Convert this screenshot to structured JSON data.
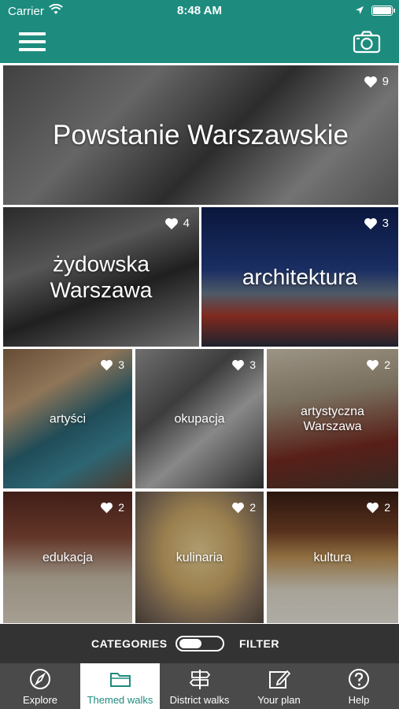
{
  "status_bar": {
    "carrier": "Carrier",
    "time": "8:48 AM"
  },
  "nav": {
    "menu_icon": "hamburger-menu-icon",
    "camera_icon": "camera-icon"
  },
  "categories": [
    {
      "label": "Powstanie Warszawskie",
      "likes": "9"
    },
    {
      "label": "żydowska Warszawa",
      "likes": "4"
    },
    {
      "label": "architektura",
      "likes": "3"
    },
    {
      "label": "artyści",
      "likes": "3"
    },
    {
      "label": "okupacja",
      "likes": "3"
    },
    {
      "label": "artystyczna Warszawa",
      "likes": "2"
    },
    {
      "label": "edukacja",
      "likes": "2"
    },
    {
      "label": "kulinaria",
      "likes": "2"
    },
    {
      "label": "kultura",
      "likes": "2"
    }
  ],
  "toggle": {
    "left_label": "CATEGORIES",
    "right_label": "FILTER"
  },
  "tabs": [
    {
      "label": "Explore",
      "icon": "compass-icon"
    },
    {
      "label": "Themed walks",
      "icon": "folder-icon"
    },
    {
      "label": "District walks",
      "icon": "signpost-icon"
    },
    {
      "label": "Your plan",
      "icon": "edit-plan-icon"
    },
    {
      "label": "Help",
      "icon": "help-icon"
    }
  ],
  "colors": {
    "brand_teal": "#1d8c7e",
    "toolbar_dark": "#333333",
    "tabbar_gray": "#4a4a4a"
  }
}
